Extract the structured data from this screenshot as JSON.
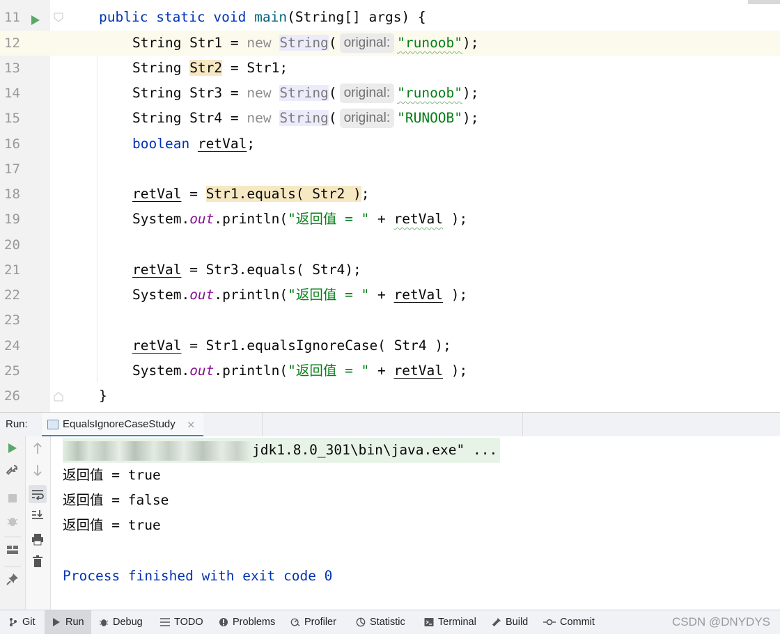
{
  "editor": {
    "lines": [
      {
        "no": "11",
        "tokens": [
          "public",
          "static",
          "void",
          "main",
          "(String[] args) {"
        ]
      },
      {
        "no": "12",
        "tokens": [
          "String Str1 = ",
          "new",
          "String",
          "(",
          "original:",
          "\"runoob\"",
          ");"
        ]
      },
      {
        "no": "13",
        "tokens": [
          "String ",
          "Str2",
          " = Str1;"
        ]
      },
      {
        "no": "14",
        "tokens": [
          "String Str3 = ",
          "new",
          "String",
          "(",
          "original:",
          "\"runoob\"",
          ");"
        ]
      },
      {
        "no": "15",
        "tokens": [
          "String Str4 = ",
          "new",
          "String",
          "(",
          "original:",
          "\"RUNOOB\"",
          ");"
        ]
      },
      {
        "no": "16",
        "tokens": [
          "boolean",
          "retVal",
          ";"
        ]
      },
      {
        "no": "17",
        "tokens": []
      },
      {
        "no": "18",
        "tokens": [
          "retVal",
          " = ",
          "Str1.equals( Str2 )",
          ";"
        ]
      },
      {
        "no": "19",
        "tokens": [
          "System.",
          "out",
          ".println(",
          "\"返回值 = \"",
          " + ",
          "retVal",
          " );"
        ]
      },
      {
        "no": "20",
        "tokens": []
      },
      {
        "no": "21",
        "tokens": [
          "retVal",
          " = Str3.equals( Str4);"
        ]
      },
      {
        "no": "22",
        "tokens": [
          "System.",
          "out",
          ".println(",
          "\"返回值 = \"",
          " + ",
          "retVal",
          " );"
        ]
      },
      {
        "no": "23",
        "tokens": []
      },
      {
        "no": "24",
        "tokens": [
          "retVal",
          " = Str1.equalsIgnoreCase( Str4 );"
        ]
      },
      {
        "no": "25",
        "tokens": [
          "System.",
          "out",
          ".println(",
          "\"返回值 = \"",
          " + ",
          "retVal",
          " );"
        ]
      },
      {
        "no": "26",
        "tokens": [
          "}"
        ]
      }
    ]
  },
  "run_panel": {
    "label": "Run:",
    "tab_label": "EqualsIgnoreCaseStudy",
    "tab_close": "×",
    "console": {
      "command_tail": "jdk1.8.0_301\\bin\\java.exe\" ...",
      "outputs": [
        "返回值 = true",
        "返回值 = false",
        "返回值 = true"
      ],
      "exit_message": "Process finished with exit code 0"
    }
  },
  "status_bar": {
    "items": [
      "Git",
      "Run",
      "Debug",
      "TODO",
      "Problems",
      "Profiler",
      "Statistic",
      "Terminal",
      "Build",
      "Commit"
    ],
    "active": "Run",
    "watermark": "CSDN @DNYDYS"
  },
  "colors": {
    "keyword": "#0033b3",
    "method": "#00627a",
    "string": "#067d17",
    "static_field": "#871094",
    "current_line": "#fcfaed",
    "run_tab_underline": "#4083c9",
    "run_icon": "#59a869"
  },
  "icons": {
    "gutter": [
      "run-gutter-icon",
      "fold-icon"
    ],
    "run_toolbar": [
      "rerun-icon",
      "wrench-icon",
      "stop-icon",
      "debug-bug-icon",
      "layout-icon",
      "pin-icon",
      "up-arrow-icon",
      "down-arrow-icon",
      "soft-wrap-icon",
      "scroll-to-end-icon",
      "print-icon",
      "trash-icon"
    ],
    "status_bar": [
      "git-icon",
      "run-icon",
      "debug-icon",
      "todo-icon",
      "problems-icon",
      "profiler-icon",
      "statistic-icon",
      "terminal-icon",
      "build-icon",
      "commit-icon"
    ]
  }
}
